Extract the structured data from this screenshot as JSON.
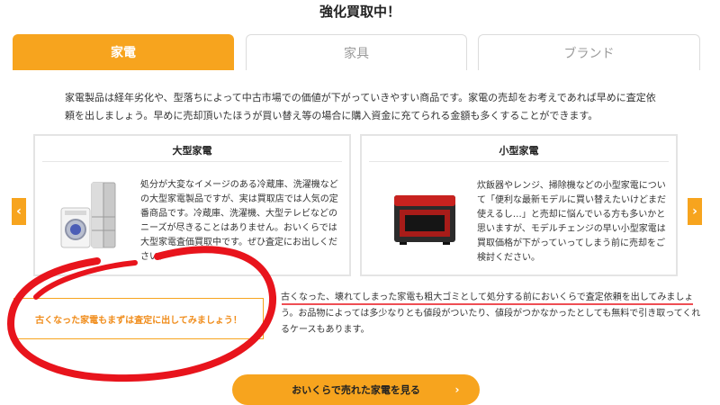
{
  "heading": "強化買取中！",
  "tabs": [
    {
      "label": "家電"
    },
    {
      "label": "家具"
    },
    {
      "label": "ブランド"
    }
  ],
  "intro": "家電製品は経年劣化や、型落ちによって中古市場での価値が下がっていきやすい商品です。家電の売却をお考えであれば早めに査定依頼を出しましょう。早めに売却頂いたほうが買い替え等の場合に購入資金に充てられる金額も多くすることができます。",
  "cards": {
    "large": {
      "title": "大型家電",
      "text": "処分が大変なイメージのある冷蔵庫、洗濯機などの大型家電製品ですが、実は買取店では人気の定番商品です。冷蔵庫、洗濯機、大型テレビなどのニーズが尽きることはありません。おいくらでは大型家電査価買取中です。ぜひ査定にお出しください。"
    },
    "small": {
      "title": "小型家電",
      "text": "炊飯器やレンジ、掃除機などの小型家電について「便利な最新モデルに買い替えたいけどまだ使えるし…」と売却に悩んでいる方も多いかと思いますが、モデルチェンジの早い小型家電は買取価格が下がっていってしまう前に売却をご検討ください。"
    }
  },
  "callout": {
    "label": "古くなった家電もまずは査定に出してみましょう！",
    "text": "古くなった、壊れてしまった家電も粗大ゴミとして処分する前においくらで査定依頼を出してみましょう。お品物によっては多少なりとも値段がついたり、値段がつかなかったとしても無料で引き取ってくれるケースもあります。"
  },
  "cta": {
    "label": "おいくらで売れた家電を見る"
  },
  "icons": {
    "prev": "chevron-left-icon",
    "next": "chevron-right-icon",
    "cta": "chevron-right-icon"
  },
  "colors": {
    "accent": "#f7a41e",
    "annotation": "#e8141c"
  }
}
